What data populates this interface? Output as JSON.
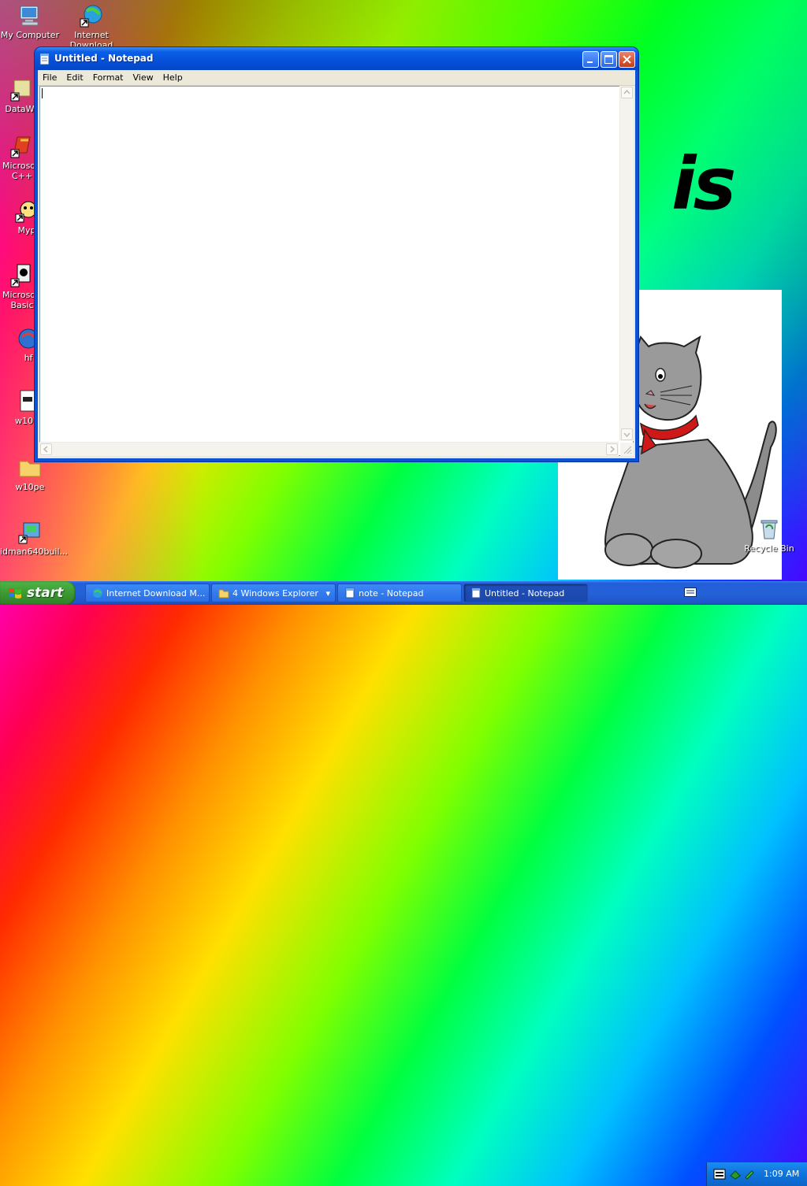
{
  "desktop": {
    "icons": [
      {
        "label": "My Computer",
        "icon": "my-computer-icon"
      },
      {
        "label": "Internet Download",
        "icon": "internet-download-icon"
      },
      {
        "label": "DataWa",
        "icon": "datawa-shortcut-icon"
      },
      {
        "label": "Microsoft C++",
        "icon": "microsoft-cpp-icon"
      },
      {
        "label": "Myp",
        "icon": "myp-shortcut-icon"
      },
      {
        "label": "Microsoft Basic",
        "icon": "microsoft-basic-icon"
      },
      {
        "label": "hf",
        "icon": "hf-shortcut-icon"
      },
      {
        "label": "w10p",
        "icon": "w10p-file-icon"
      },
      {
        "label": "w10pe",
        "icon": "w10pe-folder-icon"
      },
      {
        "label": "idman640buil...",
        "icon": "idman-installer-icon"
      },
      {
        "label": "Recycle Bin",
        "icon": "recycle-bin-icon"
      }
    ],
    "wallpaper_text": "is"
  },
  "notepad": {
    "title": "Untitled - Notepad",
    "menu": [
      "File",
      "Edit",
      "Format",
      "View",
      "Help"
    ],
    "content": ""
  },
  "taskbar": {
    "start_label": "start",
    "tasks": [
      {
        "label": "Internet Download M...",
        "icon": "idm-icon",
        "active": false
      },
      {
        "label": "4 Windows Explorer",
        "icon": "folder-icon",
        "active": false
      },
      {
        "label": "note - Notepad",
        "icon": "notepad-icon",
        "active": false
      },
      {
        "label": "Untitled - Notepad",
        "icon": "notepad-icon",
        "active": true
      }
    ],
    "clock": "1:09 AM"
  },
  "colors": {
    "titlebar": "#0550d9",
    "taskbar": "#245edb",
    "start_button": "#3c9a32",
    "tray": "#0f73dc"
  }
}
